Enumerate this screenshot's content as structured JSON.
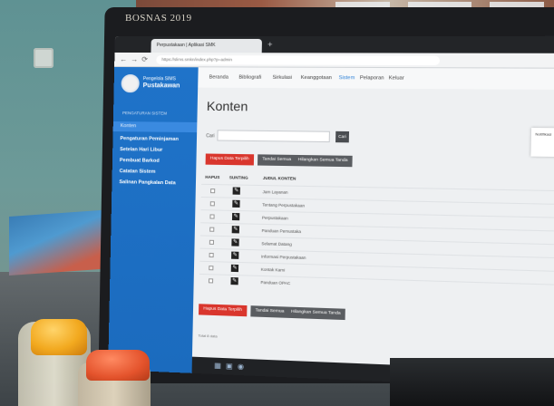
{
  "scene": {
    "monitor_label": "BOSNAS 2019"
  },
  "browser": {
    "tab_title": "Perpustakaan | Aplikasi SMK",
    "url": "https://slims.smkn/index.php?p=admin"
  },
  "sidebar": {
    "user_name": "Pengelola SIMS",
    "user_role": "Pustakawan",
    "section_heading": "PENGATURAN SISTEM",
    "items": [
      {
        "label": "Konten"
      },
      {
        "label": "Pengaturan Peminjaman"
      },
      {
        "label": "Setelan Hari Libur"
      },
      {
        "label": "Pembuat Barkod"
      },
      {
        "label": "Catatan Sistem"
      },
      {
        "label": "Salinan Pangkalan Data"
      }
    ]
  },
  "topnav": {
    "items": [
      {
        "label": "Beranda"
      },
      {
        "label": "Bibliografi"
      },
      {
        "label": "Sirkulasi"
      },
      {
        "label": "Keanggotaan"
      },
      {
        "label": "Sistem"
      },
      {
        "label": "Pelaporan"
      },
      {
        "label": "Keluar"
      }
    ]
  },
  "main": {
    "page_title": "Konten",
    "search_label": "Cari",
    "search_button": "Cari",
    "actions": {
      "delete_selected": "Hapus Data Terpilih",
      "check_all": "Tandai Semua",
      "uncheck_all": "Hilangkan Semua Tanda"
    },
    "columns": [
      "HAPUS",
      "SUNTING",
      "JUDUL KONTEN"
    ],
    "rows": [
      {
        "title": "Jam Layanan"
      },
      {
        "title": "Tentang Perpustakaan"
      },
      {
        "title": "Perpustakaan"
      },
      {
        "title": "Panduan Pemustaka"
      },
      {
        "title": "Selamat Datang"
      },
      {
        "title": "Informasi Perpustakaan"
      },
      {
        "title": "Kontak Kami"
      },
      {
        "title": "Panduan OPAC"
      }
    ],
    "footer_note": "Total 8 data"
  },
  "popup": {
    "text": "Notifikasi"
  },
  "colors": {
    "sidebar": "#1f73c9",
    "danger": "#d9362d",
    "neutral_button": "#5a5d61"
  }
}
